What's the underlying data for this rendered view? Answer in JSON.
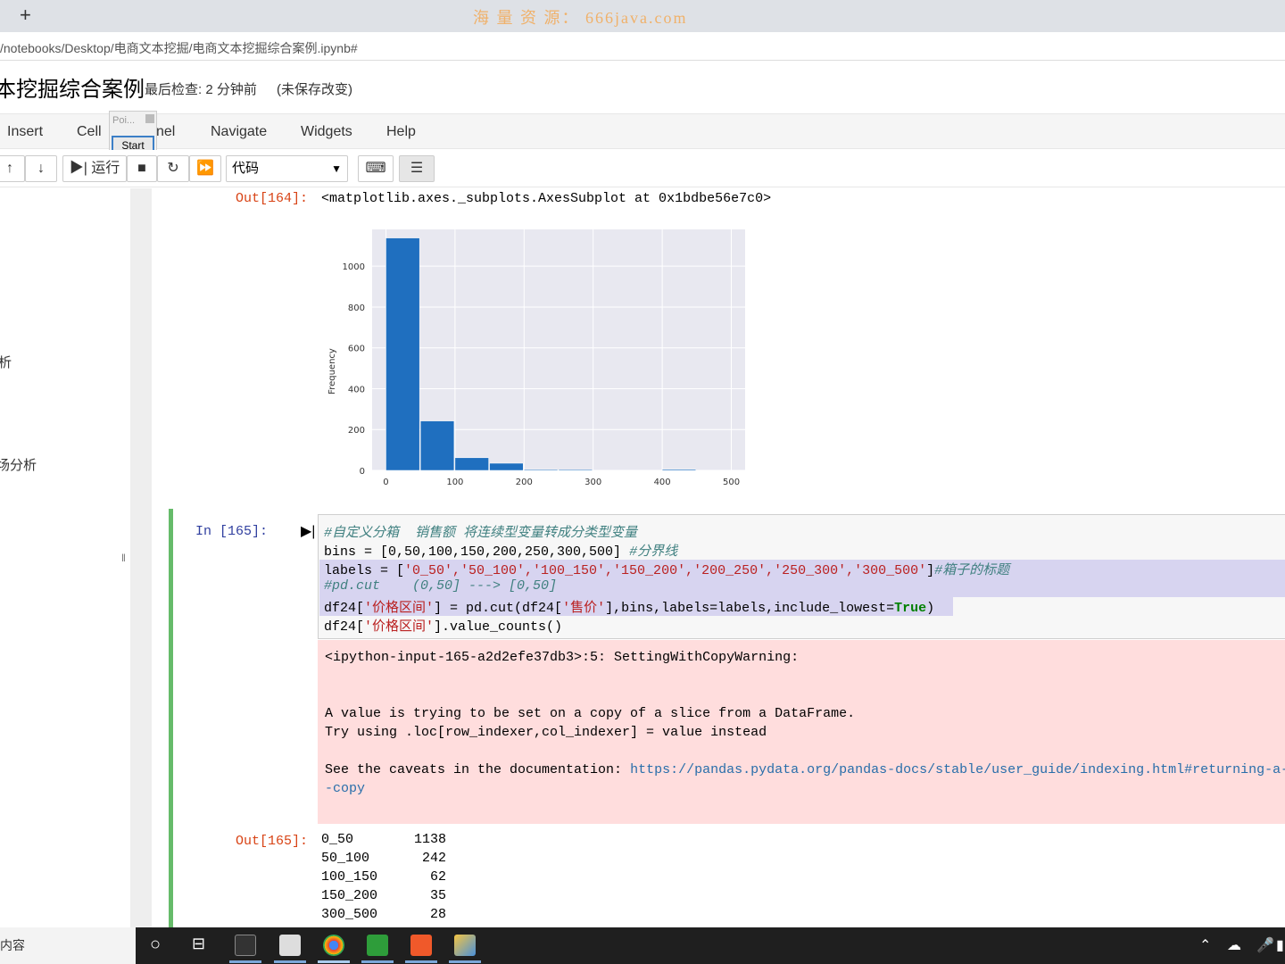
{
  "browser": {
    "new_tab_label": "+",
    "watermark": "海 量 资 源： 666java.com",
    "url": "/notebooks/Desktop/电商文本挖掘/电商文本挖掘综合案例.ipynb#"
  },
  "header": {
    "title": "本挖掘综合案例",
    "checkpoint": "最后检查: 2 分钟前",
    "unsaved": "(未保存改变)"
  },
  "menu": {
    "items": [
      "Insert",
      "Cell",
      "nel",
      "Navigate",
      "Widgets",
      "Help"
    ]
  },
  "popup": {
    "label": "Poi...",
    "start": "Start"
  },
  "toolbar": {
    "up": "↑",
    "down": "↓",
    "run": "▶| 运行",
    "stop": "■",
    "restart": "↻",
    "fastforward": "⏩",
    "cell_type": "代码",
    "keyboard": "⌨",
    "toc": "☰"
  },
  "sidebar": {
    "item1": "析",
    "item2": "场分析"
  },
  "cells": {
    "out164_prompt": "Out[164]:",
    "out164_repr": "<matplotlib.axes._subplots.AxesSubplot at 0x1bdbe56e7c0>",
    "in165_prompt": "In  [165]:",
    "code": {
      "l1": "#自定义分箱  销售额 将连续型变量转成分类型变量",
      "l2a": "bins = [0,50,100,150,200,250,300,500] ",
      "l2b": "#分界线",
      "l3a": "labels = [",
      "l3b": "'0_50','50_100','100_150','150_200','200_250','250_300','300_500'",
      "l3c": "]",
      "l3d": "#箱子的标题",
      "l4": "#pd.cut    (0,50] ---> [0,50]",
      "l5a": "df24[",
      "l5b": "'价格区间'",
      "l5c": "] = pd.cut(df24[",
      "l5d": "'售价'",
      "l5e": "],bins,labels=labels,include_lowest=",
      "l5f": "True",
      "l5g": ")",
      "l6a": "df24[",
      "l6b": "'价格区间'",
      "l6c": "].value_counts()"
    },
    "stderr": {
      "l1": "<ipython-input-165-a2d2efe37db3>:5: SettingWithCopyWarning:",
      "l2": "A value is trying to be set on a copy of a slice from a DataFrame.",
      "l3": "Try using .loc[row_indexer,col_indexer] = value instead",
      "l4": "See the caveats in the documentation: ",
      "link1": "https://pandas.pydata.org/pandas-docs/stable/user_guide/indexing.html#returning-a-",
      "link2": "-copy"
    },
    "out165_prompt": "Out[165]:",
    "value_counts": [
      {
        "label": "0_50",
        "count": "1138"
      },
      {
        "label": "50_100",
        "count": "242"
      },
      {
        "label": "100_150",
        "count": "62"
      },
      {
        "label": "150_200",
        "count": "35"
      },
      {
        "label": "300_500",
        "count": "28"
      }
    ]
  },
  "chart_data": {
    "type": "bar",
    "title": "",
    "xlabel": "",
    "ylabel": "Frequency",
    "xlim": [
      -20,
      520
    ],
    "ylim": [
      0,
      1180
    ],
    "bin_edges": [
      0,
      50,
      100,
      150,
      200,
      250,
      300,
      350,
      400,
      450,
      500
    ],
    "values": [
      1138,
      242,
      62,
      35,
      4,
      3,
      0,
      0,
      5,
      0,
      14
    ],
    "xticks": [
      "0",
      "100",
      "200",
      "300",
      "400",
      "500"
    ],
    "yticks": [
      "0",
      "200",
      "400",
      "600",
      "800",
      "1000"
    ],
    "grid": true,
    "bar_color": "#1f6fbf",
    "bg_color": "#e8e8f0"
  },
  "taskbar": {
    "search_text": "内容"
  }
}
